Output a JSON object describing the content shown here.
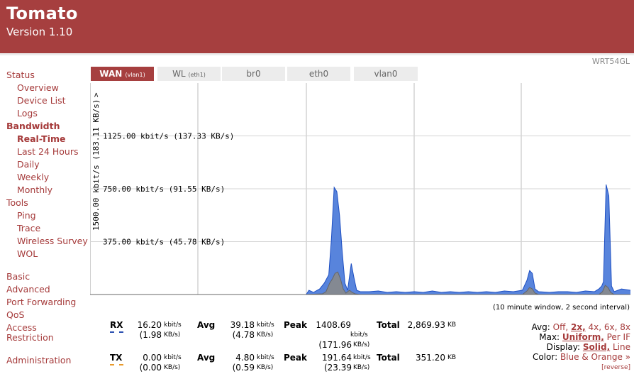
{
  "header": {
    "title": "Tomato",
    "version": "Version 1.10",
    "model": "WRT54GL"
  },
  "nav": [
    {
      "label": "Status",
      "level": 0,
      "bold": false
    },
    {
      "label": "Overview",
      "level": 1,
      "bold": false
    },
    {
      "label": "Device List",
      "level": 1,
      "bold": false
    },
    {
      "label": "Logs",
      "level": 1,
      "bold": false
    },
    {
      "label": "Bandwidth",
      "level": 0,
      "bold": true
    },
    {
      "label": "Real-Time",
      "level": 1,
      "bold": true
    },
    {
      "label": "Last 24 Hours",
      "level": 1,
      "bold": false
    },
    {
      "label": "Daily",
      "level": 1,
      "bold": false
    },
    {
      "label": "Weekly",
      "level": 1,
      "bold": false
    },
    {
      "label": "Monthly",
      "level": 1,
      "bold": false
    },
    {
      "label": "Tools",
      "level": 0,
      "bold": false
    },
    {
      "label": "Ping",
      "level": 1,
      "bold": false
    },
    {
      "label": "Trace",
      "level": 1,
      "bold": false
    },
    {
      "label": "Wireless Survey",
      "level": 1,
      "bold": false
    },
    {
      "label": "WOL",
      "level": 1,
      "bold": false
    },
    {
      "label": "Basic",
      "level": 0,
      "bold": false
    },
    {
      "label": "Advanced",
      "level": 0,
      "bold": false
    },
    {
      "label": "Port Forwarding",
      "level": 0,
      "bold": false
    },
    {
      "label": "QoS",
      "level": 0,
      "bold": false
    },
    {
      "label": "Access",
      "level": 0,
      "bold": false
    },
    {
      "label": "Restriction",
      "level": 0,
      "bold": false
    },
    {
      "label": "Administration",
      "level": 0,
      "bold": false
    }
  ],
  "tabs": [
    {
      "name": "WAN",
      "sub": "(vlan1)",
      "active": true
    },
    {
      "name": "WL",
      "sub": "(eth1)",
      "active": false
    },
    {
      "name": "br0",
      "sub": "",
      "active": false
    },
    {
      "name": "eth0",
      "sub": "",
      "active": false
    },
    {
      "name": "vlan0",
      "sub": "",
      "active": false
    }
  ],
  "graph": {
    "y_max_label": "1500.00 kbit/s (183.11 KB/s)",
    "y_max_arrow": ">",
    "gridlines": [
      "1125.00 kbit/s (137.33 KB/s)",
      "750.00 kbit/s (91.55 KB/s)",
      "375.00 kbit/s (45.78 KB/s)"
    ],
    "interval_note": "(10 minute window, 2 second interval)",
    "rx_color": "#3b6fd6",
    "tx_color": "#8a8a8a"
  },
  "chart_data": {
    "type": "area",
    "ylim": [
      0,
      1500
    ],
    "window_seconds": 600,
    "series": [
      {
        "name": "RX",
        "points": [
          [
            0,
            0
          ],
          [
            240,
            0
          ],
          [
            243,
            30
          ],
          [
            248,
            15
          ],
          [
            255,
            40
          ],
          [
            260,
            80
          ],
          [
            265,
            140
          ],
          [
            268,
            400
          ],
          [
            271,
            760
          ],
          [
            274,
            730
          ],
          [
            277,
            560
          ],
          [
            280,
            300
          ],
          [
            283,
            80
          ],
          [
            286,
            30
          ],
          [
            290,
            220
          ],
          [
            293,
            120
          ],
          [
            296,
            30
          ],
          [
            300,
            20
          ],
          [
            310,
            20
          ],
          [
            320,
            25
          ],
          [
            330,
            15
          ],
          [
            340,
            20
          ],
          [
            350,
            15
          ],
          [
            360,
            20
          ],
          [
            370,
            15
          ],
          [
            380,
            25
          ],
          [
            390,
            15
          ],
          [
            400,
            20
          ],
          [
            410,
            15
          ],
          [
            420,
            20
          ],
          [
            430,
            15
          ],
          [
            440,
            20
          ],
          [
            450,
            15
          ],
          [
            460,
            25
          ],
          [
            470,
            20
          ],
          [
            480,
            30
          ],
          [
            485,
            100
          ],
          [
            488,
            170
          ],
          [
            491,
            150
          ],
          [
            494,
            40
          ],
          [
            498,
            20
          ],
          [
            510,
            15
          ],
          [
            520,
            20
          ],
          [
            530,
            20
          ],
          [
            540,
            15
          ],
          [
            550,
            25
          ],
          [
            560,
            20
          ],
          [
            565,
            40
          ],
          [
            568,
            60
          ],
          [
            570,
            90
          ],
          [
            573,
            780
          ],
          [
            576,
            700
          ],
          [
            579,
            60
          ],
          [
            582,
            20
          ],
          [
            590,
            40
          ],
          [
            600,
            30
          ],
          [
            610,
            20
          ],
          [
            620,
            35
          ],
          [
            630,
            20
          ],
          [
            635,
            60
          ],
          [
            638,
            150
          ],
          [
            641,
            250
          ],
          [
            644,
            200
          ],
          [
            647,
            60
          ],
          [
            650,
            80
          ],
          [
            653,
            130
          ],
          [
            656,
            40
          ],
          [
            660,
            20
          ],
          [
            670,
            20
          ],
          [
            680,
            15
          ],
          [
            690,
            25
          ],
          [
            700,
            20
          ],
          [
            710,
            25
          ],
          [
            720,
            20
          ],
          [
            730,
            20
          ],
          [
            740,
            15
          ],
          [
            750,
            20
          ],
          [
            760,
            20
          ]
        ]
      },
      {
        "name": "TX",
        "points": [
          [
            0,
            0
          ],
          [
            240,
            0
          ],
          [
            258,
            5
          ],
          [
            262,
            20
          ],
          [
            266,
            80
          ],
          [
            269,
            110
          ],
          [
            272,
            150
          ],
          [
            275,
            160
          ],
          [
            278,
            110
          ],
          [
            281,
            40
          ],
          [
            284,
            10
          ],
          [
            288,
            30
          ],
          [
            291,
            15
          ],
          [
            294,
            5
          ],
          [
            300,
            0
          ],
          [
            480,
            0
          ],
          [
            485,
            25
          ],
          [
            488,
            50
          ],
          [
            491,
            40
          ],
          [
            494,
            10
          ],
          [
            498,
            0
          ],
          [
            565,
            0
          ],
          [
            569,
            20
          ],
          [
            572,
            65
          ],
          [
            575,
            50
          ],
          [
            578,
            15
          ],
          [
            582,
            0
          ],
          [
            632,
            0
          ],
          [
            636,
            25
          ],
          [
            639,
            60
          ],
          [
            642,
            50
          ],
          [
            645,
            20
          ],
          [
            648,
            30
          ],
          [
            651,
            45
          ],
          [
            654,
            10
          ],
          [
            658,
            0
          ],
          [
            760,
            0
          ]
        ]
      }
    ]
  },
  "stats": {
    "rx": {
      "label": "RX",
      "now": "16.20",
      "now_unit": "kbit/s",
      "now_kb": "(1.98",
      "now_kb_unit": "KB/s)",
      "avg_label": "Avg",
      "avg": "39.18",
      "avg_unit": "kbit/s",
      "avg_kb": "(4.78",
      "avg_kb_unit": "KB/s)",
      "peak_label": "Peak",
      "peak": "1408.69",
      "peak_unit": "kbit/s",
      "peak_kb": "(171.96",
      "peak_kb_unit": "KB/s)",
      "total_label": "Total",
      "total": "2,869.93",
      "total_unit": "KB",
      "color": "#2a4fb0"
    },
    "tx": {
      "label": "TX",
      "now": "0.00",
      "now_unit": "kbit/s",
      "now_kb": "(0.00",
      "now_kb_unit": "KB/s)",
      "avg_label": "Avg",
      "avg": "4.80",
      "avg_unit": "kbit/s",
      "avg_kb": "(0.59",
      "avg_kb_unit": "KB/s)",
      "peak_label": "Peak",
      "peak": "191.64",
      "peak_unit": "kbit/s",
      "peak_kb": "(23.39",
      "peak_kb_unit": "KB/s)",
      "total_label": "Total",
      "total": "351.20",
      "total_unit": "KB",
      "color": "#e89a2c"
    }
  },
  "options": {
    "avg_label": "Avg:",
    "avg_opts": [
      "Off,",
      "2x,",
      "4x,",
      "6x,",
      "8x"
    ],
    "avg_selected": 1,
    "max_label": "Max:",
    "max_opts": [
      "Uniform,",
      "Per IF"
    ],
    "max_selected": 0,
    "display_label": "Display:",
    "display_opts": [
      "Solid,",
      "Line"
    ],
    "display_selected": 0,
    "color_label": "Color:",
    "color_value": "Blue & Orange »",
    "reverse": "[reverse]"
  }
}
